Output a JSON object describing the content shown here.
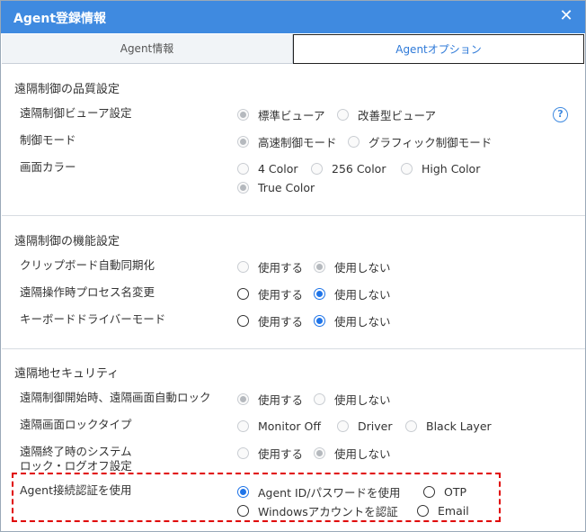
{
  "window": {
    "title": "Agent登録情報",
    "close_icon": "close-icon"
  },
  "tabs": [
    {
      "label": "Agent情報",
      "active": false
    },
    {
      "label": "Agentオプション",
      "active": true
    }
  ],
  "colors": {
    "accent": "#3f8ae0",
    "radio_checked": "#1f74e8",
    "highlight": "#e00000"
  },
  "sections": [
    {
      "title": "遠隔制御の品質設定",
      "rows": [
        {
          "label": "遠隔制御ビューア設定",
          "options": [
            "標準ビューア",
            "改善型ビューア"
          ],
          "selected": 0,
          "disabled": true
        },
        {
          "label": "制御モード",
          "options": [
            "高速制御モード",
            "グラフィック制御モード"
          ],
          "selected": 0,
          "disabled": true
        },
        {
          "label": "画面カラー",
          "options": [
            "4 Color",
            "256 Color",
            "High Color",
            "True Color"
          ],
          "selected": 3,
          "disabled": true
        }
      ]
    },
    {
      "title": "遠隔制御の機能設定",
      "rows": [
        {
          "label": "クリップボード自動同期化",
          "options": [
            "使用する",
            "使用しない"
          ],
          "selected": 1,
          "disabled": true
        },
        {
          "label": "遠隔操作時プロセス名変更",
          "options": [
            "使用する",
            "使用しない"
          ],
          "selected": 1,
          "disabled": false
        },
        {
          "label": "キーボードドライバーモード",
          "options": [
            "使用する",
            "使用しない"
          ],
          "selected": 1,
          "disabled": false
        }
      ]
    },
    {
      "title": "遠隔地セキュリティ",
      "rows": [
        {
          "label": "遠隔制御開始時、遠隔画面自動ロック",
          "options": [
            "使用する",
            "使用しない"
          ],
          "selected": 0,
          "disabled": true
        },
        {
          "label": "遠隔画面ロックタイプ",
          "options": [
            "Monitor Off",
            "Driver",
            "Black Layer"
          ],
          "selected": -1,
          "disabled": true
        },
        {
          "label": "遠隔終了時のシステム",
          "label2": "ロック・ログオフ設定",
          "options": [
            "使用する",
            "使用しない"
          ],
          "selected": 1,
          "disabled": true
        },
        {
          "label": "Agent接続認証を使用",
          "options": [
            "Agent ID/パスワードを使用",
            "OTP",
            "Windowsアカウントを認証",
            "Email"
          ],
          "selected": 0,
          "disabled": false
        }
      ]
    }
  ],
  "help_icon": "question-circle-icon",
  "help_glyph": "?"
}
